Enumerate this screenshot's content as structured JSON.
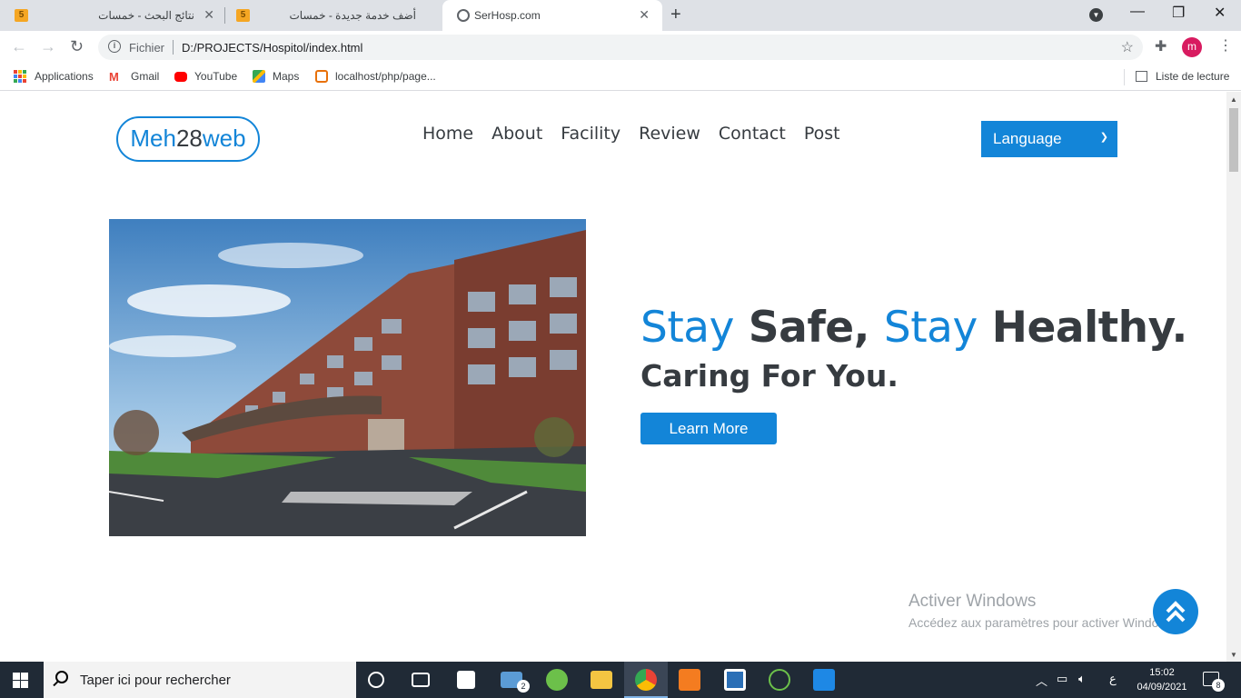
{
  "browser": {
    "tabs": [
      {
        "title": "نتائج البحث - خمسات",
        "favicon": "5",
        "active": false
      },
      {
        "title": "أضف خدمة جديدة - خمسات",
        "favicon": "5",
        "active": false
      },
      {
        "title": "SerHosp.com",
        "favicon": "globe-icon",
        "active": true
      }
    ],
    "address": {
      "scheme": "Fichier",
      "url": "D:/PROJECTS/Hospitol/index.html"
    },
    "profile_initial": "m",
    "bookmarks": [
      {
        "label": "Applications"
      },
      {
        "label": "Gmail"
      },
      {
        "label": "YouTube"
      },
      {
        "label": "Maps"
      },
      {
        "label": "localhost/php/page..."
      }
    ],
    "reading_list": "Liste de lecture"
  },
  "site": {
    "logo": {
      "part1": "Meh",
      "part2": "28",
      "part3": "web"
    },
    "nav": [
      "Home",
      "About",
      "Facility",
      "Review",
      "Contact",
      "Post"
    ],
    "language_select": "Language",
    "hero": {
      "word1": "Stay",
      "word2": "Safe,",
      "word3": "Stay",
      "word4": "Healthy.",
      "subtitle": "Caring For You.",
      "cta": "Learn More"
    },
    "accent_color": "#1385d8",
    "text_color": "#363b40"
  },
  "windows": {
    "activate_title": "Activer Windows",
    "activate_sub": "Accédez aux paramètres pour activer Windows.",
    "search_placeholder": "Taper ici pour rechercher",
    "mail_badge": "2",
    "tray_lang": "ع",
    "time": "15:02",
    "date": "04/09/2021",
    "notifications": "8"
  }
}
